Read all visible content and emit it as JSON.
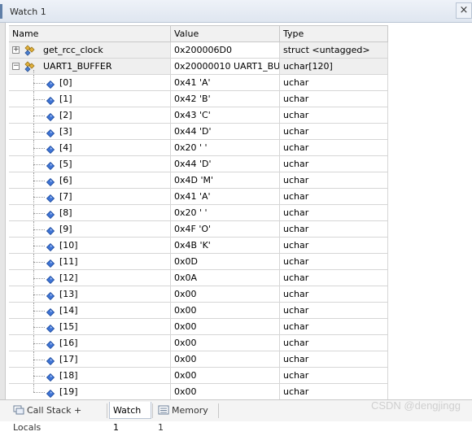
{
  "window": {
    "title": "Watch 1",
    "close_glyph": "×"
  },
  "columns": {
    "name": "Name",
    "value": "Value",
    "type": "Type"
  },
  "top_rows": [
    {
      "name": "get_rcc_clock",
      "value": "0x200006D0",
      "type": "struct <untagged>",
      "expander": "+",
      "icon": "struct-icon"
    },
    {
      "name": "UART1_BUFFER",
      "value": "0x20000010 UART1_BU...",
      "type": "uchar[120]",
      "expander": "−",
      "icon": "struct-icon"
    }
  ],
  "buffer_items": [
    {
      "name": "[0]",
      "value": "0x41 'A'",
      "type": "uchar"
    },
    {
      "name": "[1]",
      "value": "0x42 'B'",
      "type": "uchar"
    },
    {
      "name": "[2]",
      "value": "0x43 'C'",
      "type": "uchar"
    },
    {
      "name": "[3]",
      "value": "0x44 'D'",
      "type": "uchar"
    },
    {
      "name": "[4]",
      "value": "0x20 ' '",
      "type": "uchar"
    },
    {
      "name": "[5]",
      "value": "0x44 'D'",
      "type": "uchar"
    },
    {
      "name": "[6]",
      "value": "0x4D 'M'",
      "type": "uchar"
    },
    {
      "name": "[7]",
      "value": "0x41 'A'",
      "type": "uchar"
    },
    {
      "name": "[8]",
      "value": "0x20 ' '",
      "type": "uchar"
    },
    {
      "name": "[9]",
      "value": "0x4F 'O'",
      "type": "uchar"
    },
    {
      "name": "[10]",
      "value": "0x4B 'K'",
      "type": "uchar"
    },
    {
      "name": "[11]",
      "value": "0x0D",
      "type": "uchar"
    },
    {
      "name": "[12]",
      "value": "0x0A",
      "type": "uchar"
    },
    {
      "name": "[13]",
      "value": "0x00",
      "type": "uchar"
    },
    {
      "name": "[14]",
      "value": "0x00",
      "type": "uchar"
    },
    {
      "name": "[15]",
      "value": "0x00",
      "type": "uchar"
    },
    {
      "name": "[16]",
      "value": "0x00",
      "type": "uchar"
    },
    {
      "name": "[17]",
      "value": "0x00",
      "type": "uchar"
    },
    {
      "name": "[18]",
      "value": "0x00",
      "type": "uchar"
    },
    {
      "name": "[19]",
      "value": "0x00",
      "type": "uchar"
    }
  ],
  "tabs": [
    {
      "label": "Call Stack + Locals",
      "icon": "call-stack-icon",
      "active": false
    },
    {
      "label": "Watch 1",
      "icon": "",
      "active": true
    },
    {
      "label": "Memory 1",
      "icon": "memory-icon",
      "active": false
    }
  ],
  "watermark": "CSDN @dengjingg",
  "colors": {
    "element_icon": "#2a63c6",
    "struct_icon": "#c89a2a",
    "active_tab_border": "#b9c4d4"
  }
}
